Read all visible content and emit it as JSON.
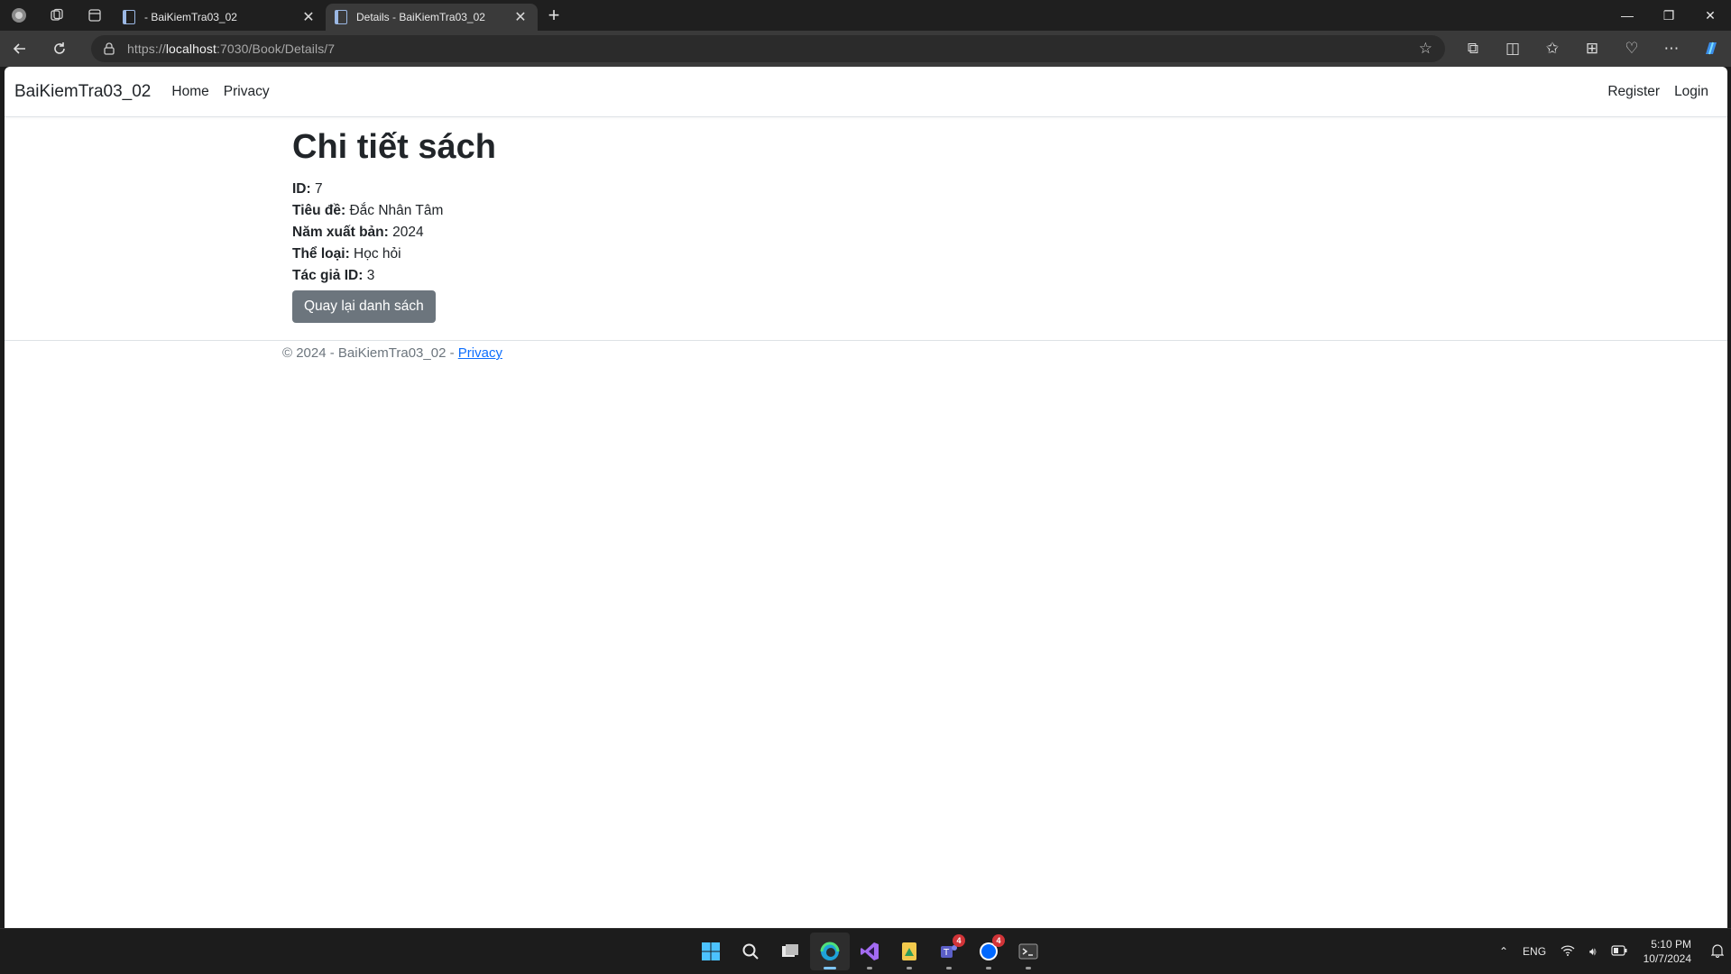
{
  "browser": {
    "tabs": [
      {
        "title": "- BaiKiemTra03_02",
        "active": false
      },
      {
        "title": "Details - BaiKiemTra03_02",
        "active": true
      }
    ],
    "url_prefix": "https://",
    "url_host": "localhost",
    "url_rest": ":7030/Book/Details/7"
  },
  "site": {
    "brand": "BaiKiemTra03_02",
    "nav": {
      "home": "Home",
      "privacy": "Privacy",
      "register": "Register",
      "login": "Login"
    }
  },
  "details": {
    "title": "Chi tiết sách",
    "fields": [
      {
        "label": "ID:",
        "value": "7"
      },
      {
        "label": "Tiêu đề:",
        "value": "Đắc Nhân Tâm"
      },
      {
        "label": "Năm xuất bản:",
        "value": "2024"
      },
      {
        "label": "Thể loại:",
        "value": "Học hỏi"
      },
      {
        "label": "Tác giả ID:",
        "value": "3"
      }
    ],
    "back_button": "Quay lại danh sách"
  },
  "footer": {
    "text": "© 2024 - BaiKiemTra03_02 - ",
    "privacy_link": "Privacy"
  },
  "taskbar": {
    "teams_badge": "4",
    "zalo_badge": "4",
    "language": "ENG",
    "time": "5:10 PM",
    "date": "10/7/2024"
  },
  "colors": {
    "button_bg": "#6c757d",
    "link": "#0d6efd",
    "text": "#212529"
  }
}
